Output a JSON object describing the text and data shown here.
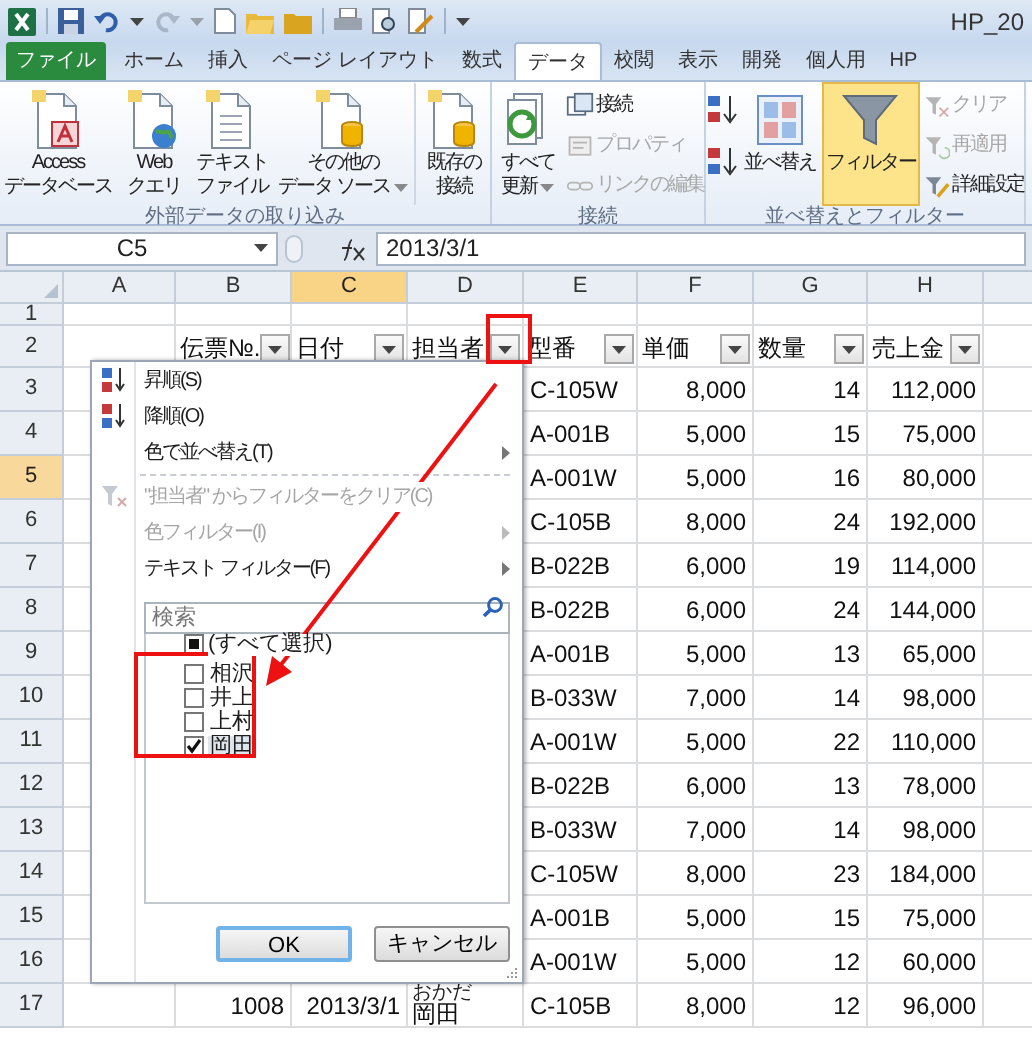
{
  "title_bar": {
    "title": "HP_20"
  },
  "tabs": [
    {
      "label": "ファイル",
      "kind": "file",
      "selected": false
    },
    {
      "label": "ホーム",
      "kind": "tab",
      "selected": false
    },
    {
      "label": "挿入",
      "kind": "tab",
      "selected": false
    },
    {
      "label": "ページ レイアウト",
      "kind": "tab",
      "selected": false
    },
    {
      "label": "数式",
      "kind": "tab",
      "selected": false
    },
    {
      "label": "データ",
      "kind": "tab",
      "selected": true
    },
    {
      "label": "校閲",
      "kind": "tab",
      "selected": false
    },
    {
      "label": "表示",
      "kind": "tab",
      "selected": false
    },
    {
      "label": "開発",
      "kind": "tab",
      "selected": false
    },
    {
      "label": "個人用",
      "kind": "tab",
      "selected": false
    },
    {
      "label": "HP",
      "kind": "tab",
      "selected": false
    }
  ],
  "ribbon_groups": [
    {
      "label": "外部データの取り込み",
      "buttons": [
        {
          "kind": "large",
          "lines": [
            "Access",
            "データベース"
          ],
          "dropdown": false,
          "separated": false,
          "on": false
        },
        {
          "kind": "large",
          "lines": [
            "Web",
            "クエリ"
          ],
          "dropdown": false,
          "separated": false,
          "on": false
        },
        {
          "kind": "large",
          "lines": [
            "テキスト",
            "ファイル"
          ],
          "dropdown": false,
          "separated": false,
          "on": false
        },
        {
          "kind": "large",
          "lines": [
            "その他の",
            "データ ソース"
          ],
          "dropdown": true,
          "separated": false,
          "on": false
        },
        {
          "kind": "large",
          "lines": [
            "既存の",
            "接続"
          ],
          "dropdown": false,
          "separated": true,
          "on": false
        }
      ]
    },
    {
      "label": "接続",
      "buttons": [
        {
          "kind": "large",
          "lines": [
            "すべて",
            "更新"
          ],
          "dropdown": true,
          "separated": false,
          "on": false
        },
        {
          "kind": "stack",
          "items": [
            {
              "label": "接続",
              "disabled": false
            },
            {
              "label": "プロパティ",
              "disabled": true
            },
            {
              "label": "リンクの編集",
              "disabled": true
            }
          ]
        }
      ]
    },
    {
      "label": "並べ替えとフィルター",
      "buttons": [
        {
          "kind": "sort_icons"
        },
        {
          "kind": "large",
          "lines": [
            "並べ替え"
          ],
          "dropdown": false,
          "separated": false,
          "on": false
        },
        {
          "kind": "large",
          "lines": [
            "フィルター"
          ],
          "dropdown": false,
          "separated": false,
          "on": true
        },
        {
          "kind": "stack",
          "items": [
            {
              "label": "クリア",
              "disabled": true
            },
            {
              "label": "再適用",
              "disabled": true
            },
            {
              "label": "詳細設定",
              "disabled": false
            }
          ]
        }
      ]
    }
  ],
  "formula_bar": {
    "name_box": "C5",
    "formula": "2013/3/1"
  },
  "columns": [
    {
      "label": "A",
      "selected": false
    },
    {
      "label": "B",
      "selected": false
    },
    {
      "label": "C",
      "selected": true
    },
    {
      "label": "D",
      "selected": false
    },
    {
      "label": "E",
      "selected": false
    },
    {
      "label": "F",
      "selected": false
    },
    {
      "label": "G",
      "selected": false
    },
    {
      "label": "H",
      "selected": false
    }
  ],
  "rows": [
    {
      "label": "1",
      "selected": false,
      "kind": "empty",
      "cells": []
    },
    {
      "label": "2",
      "selected": false,
      "kind": "header",
      "cells": [
        {
          "text": "伝票№."
        },
        {
          "text": "日付"
        },
        {
          "text": "担当者"
        },
        {
          "text": "型番"
        },
        {
          "text": "単価"
        },
        {
          "text": "数量"
        },
        {
          "text": "売上金"
        }
      ]
    },
    {
      "label": "3",
      "selected": false,
      "kind": "covered",
      "cells": [
        {
          "text": "C-105W"
        },
        {
          "text": "8,000"
        },
        {
          "text": "14"
        },
        {
          "text": "112,000"
        }
      ]
    },
    {
      "label": "4",
      "selected": false,
      "kind": "covered",
      "cells": [
        {
          "text": "A-001B"
        },
        {
          "text": "5,000"
        },
        {
          "text": "15"
        },
        {
          "text": "75,000"
        }
      ]
    },
    {
      "label": "5",
      "selected": true,
      "kind": "covered",
      "cells": [
        {
          "text": "A-001W"
        },
        {
          "text": "5,000"
        },
        {
          "text": "16"
        },
        {
          "text": "80,000"
        }
      ]
    },
    {
      "label": "6",
      "selected": false,
      "kind": "covered",
      "cells": [
        {
          "text": "C-105B"
        },
        {
          "text": "8,000"
        },
        {
          "text": "24"
        },
        {
          "text": "192,000"
        }
      ]
    },
    {
      "label": "7",
      "selected": false,
      "kind": "covered",
      "cells": [
        {
          "text": "B-022B"
        },
        {
          "text": "6,000"
        },
        {
          "text": "19"
        },
        {
          "text": "114,000"
        }
      ]
    },
    {
      "label": "8",
      "selected": false,
      "kind": "covered",
      "cells": [
        {
          "text": "B-022B"
        },
        {
          "text": "6,000"
        },
        {
          "text": "24"
        },
        {
          "text": "144,000"
        }
      ]
    },
    {
      "label": "9",
      "selected": false,
      "kind": "covered",
      "cells": [
        {
          "text": "A-001B"
        },
        {
          "text": "5,000"
        },
        {
          "text": "13"
        },
        {
          "text": "65,000"
        }
      ]
    },
    {
      "label": "10",
      "selected": false,
      "kind": "covered",
      "cells": [
        {
          "text": "B-033W"
        },
        {
          "text": "7,000"
        },
        {
          "text": "14"
        },
        {
          "text": "98,000"
        }
      ]
    },
    {
      "label": "11",
      "selected": false,
      "kind": "covered",
      "cells": [
        {
          "text": "A-001W"
        },
        {
          "text": "5,000"
        },
        {
          "text": "22"
        },
        {
          "text": "110,000"
        }
      ]
    },
    {
      "label": "12",
      "selected": false,
      "kind": "covered",
      "cells": [
        {
          "text": "B-022B"
        },
        {
          "text": "6,000"
        },
        {
          "text": "13"
        },
        {
          "text": "78,000"
        }
      ]
    },
    {
      "label": "13",
      "selected": false,
      "kind": "covered",
      "cells": [
        {
          "text": "B-033W"
        },
        {
          "text": "7,000"
        },
        {
          "text": "14"
        },
        {
          "text": "98,000"
        }
      ]
    },
    {
      "label": "14",
      "selected": false,
      "kind": "covered",
      "cells": [
        {
          "text": "C-105W"
        },
        {
          "text": "8,000"
        },
        {
          "text": "23"
        },
        {
          "text": "184,000"
        }
      ]
    },
    {
      "label": "15",
      "selected": false,
      "kind": "covered",
      "cells": [
        {
          "text": "A-001B"
        },
        {
          "text": "5,000"
        },
        {
          "text": "15"
        },
        {
          "text": "75,000"
        }
      ]
    },
    {
      "label": "16",
      "selected": false,
      "kind": "covered",
      "cells": [
        {
          "text": "A-001W"
        },
        {
          "text": "5,000"
        },
        {
          "text": "12"
        },
        {
          "text": "60,000"
        }
      ]
    },
    {
      "label": "17",
      "selected": false,
      "kind": "full",
      "cells": [
        {
          "text": "1008"
        },
        {
          "text": "2013/3/1"
        },
        {
          "text": "岡田",
          "ruby": "おかだ"
        },
        {
          "text": "C-105B"
        },
        {
          "text": "8,000"
        },
        {
          "text": "12"
        },
        {
          "text": "96,000"
        }
      ]
    }
  ],
  "filter_menu": {
    "items": [
      {
        "kind": "command",
        "label": "昇順(S)",
        "disabled": false,
        "submenu": false
      },
      {
        "kind": "command",
        "label": "降順(O)",
        "disabled": false,
        "submenu": false
      },
      {
        "kind": "command",
        "label": "色で並べ替え(T)",
        "disabled": false,
        "submenu": true
      },
      {
        "kind": "separator"
      },
      {
        "kind": "command",
        "label": "\"担当者\" からフィルターをクリア(C)",
        "disabled": true,
        "submenu": false
      },
      {
        "kind": "command",
        "label": "色フィルター(I)",
        "disabled": true,
        "submenu": true
      },
      {
        "kind": "command",
        "label": "テキスト フィルター(F)",
        "disabled": false,
        "submenu": true
      }
    ],
    "search": {
      "placeholder": "検索"
    },
    "checklist": {
      "label": "(すべて選択)",
      "checked": false,
      "indeterminate": true,
      "children": [
        {
          "label": "相沢",
          "checked": false,
          "selected": false
        },
        {
          "label": "井上",
          "checked": false,
          "selected": false
        },
        {
          "label": "上村",
          "checked": false,
          "selected": false
        },
        {
          "label": "岡田",
          "checked": true,
          "selected": true
        }
      ]
    },
    "buttons": [
      {
        "label": "OK",
        "default": true
      },
      {
        "label": "キャンセル",
        "default": false
      }
    ]
  }
}
